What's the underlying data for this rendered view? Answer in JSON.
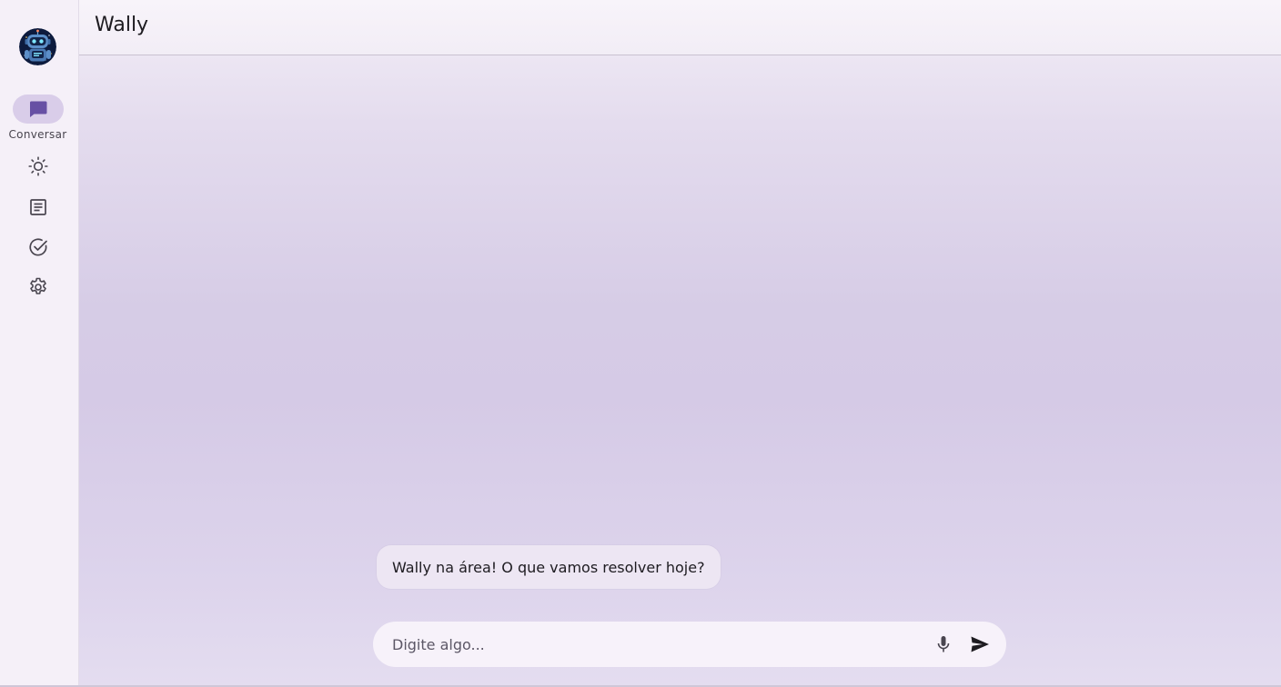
{
  "app": {
    "title": "Wally",
    "accent_color": "#6750a4",
    "active_pill_color": "#d9cde9"
  },
  "rail": {
    "avatar": "robot-avatar",
    "items": [
      {
        "id": "chat",
        "label": "Conversar",
        "icon": "chat-bubble-icon",
        "active": true
      },
      {
        "id": "theme",
        "label": "",
        "icon": "sun-icon",
        "active": false
      },
      {
        "id": "notes",
        "label": "",
        "icon": "document-list-icon",
        "active": false
      },
      {
        "id": "tasks",
        "label": "",
        "icon": "check-circle-icon",
        "active": false
      },
      {
        "id": "settings",
        "label": "",
        "icon": "gear-icon",
        "active": false
      }
    ]
  },
  "chat": {
    "messages": [
      {
        "sender": "assistant",
        "text": "Wally na área! O que vamos resolver hoje?"
      }
    ]
  },
  "composer": {
    "placeholder": "Digite algo...",
    "value": "",
    "mic_icon": "microphone-icon",
    "send_icon": "send-icon"
  }
}
